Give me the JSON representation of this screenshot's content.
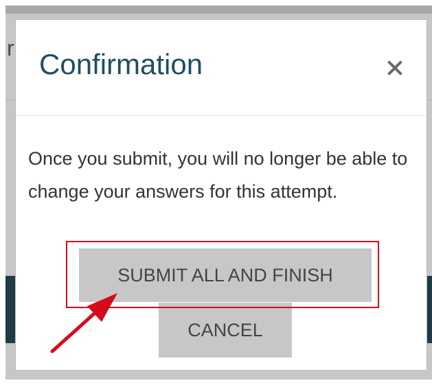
{
  "dialog": {
    "title": "Confirmation",
    "close_label": "×",
    "message": "Once you submit, you will no longer be able to change your answers for this attempt.",
    "submit_label": "SUBMIT ALL AND FINISH",
    "cancel_label": "CANCEL"
  },
  "background": {
    "partial_text": "r"
  },
  "annotation": {
    "color": "#d60a1a"
  }
}
